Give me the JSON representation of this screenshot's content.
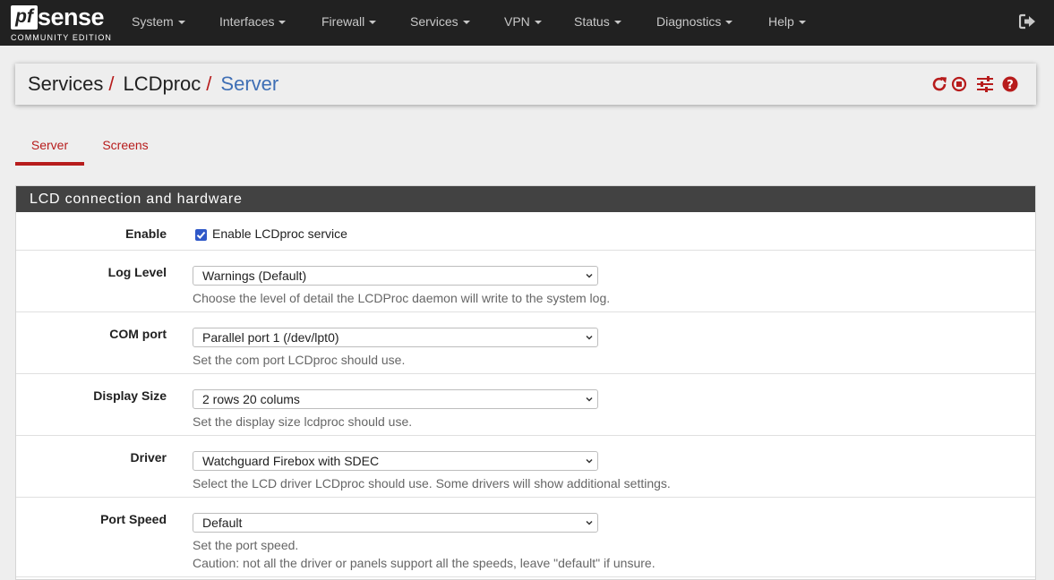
{
  "brand": {
    "pf": "pf",
    "sense": "sense",
    "edition": "COMMUNITY EDITION"
  },
  "nav": {
    "items": [
      "System",
      "Interfaces",
      "Firewall",
      "Services",
      "VPN",
      "Status",
      "Diagnostics",
      "Help"
    ],
    "logout_icon": "sign-out-icon"
  },
  "breadcrumb": {
    "items": [
      "Services",
      "LCDproc"
    ],
    "current": "Server",
    "separator": "/"
  },
  "crumb_actions": [
    "restart-icon",
    "stop-icon",
    "settings-sliders-icon",
    "help-icon"
  ],
  "tabs": [
    {
      "label": "Server",
      "active": true
    },
    {
      "label": "Screens",
      "active": false
    }
  ],
  "panel": {
    "title": "LCD connection and hardware",
    "enable": {
      "label": "Enable",
      "checkbox_label": "Enable LCDproc service",
      "checked": true
    },
    "fields": [
      {
        "label": "Log Level",
        "value": "Warnings (Default)",
        "help": [
          "Choose the level of detail the LCDProc daemon will write to the system log."
        ]
      },
      {
        "label": "COM port",
        "value": "Parallel port 1 (/dev/lpt0)",
        "help": [
          "Set the com port LCDproc should use."
        ]
      },
      {
        "label": "Display Size",
        "value": "2 rows 20 colums",
        "help": [
          "Set the display size lcdproc should use."
        ]
      },
      {
        "label": "Driver",
        "value": "Watchguard Firebox with SDEC",
        "help": [
          "Select the LCD driver LCDproc should use. Some drivers will show additional settings."
        ]
      },
      {
        "label": "Port Speed",
        "value": "Default",
        "help": [
          "Set the port speed.",
          "Caution: not all the driver or panels support all the speeds, leave \"default\" if unsure."
        ]
      }
    ]
  },
  "colors": {
    "navbar": "#212121",
    "accent_red": "#b71c1c",
    "link_blue": "#3f6fb5",
    "panel_head": "#424242"
  }
}
